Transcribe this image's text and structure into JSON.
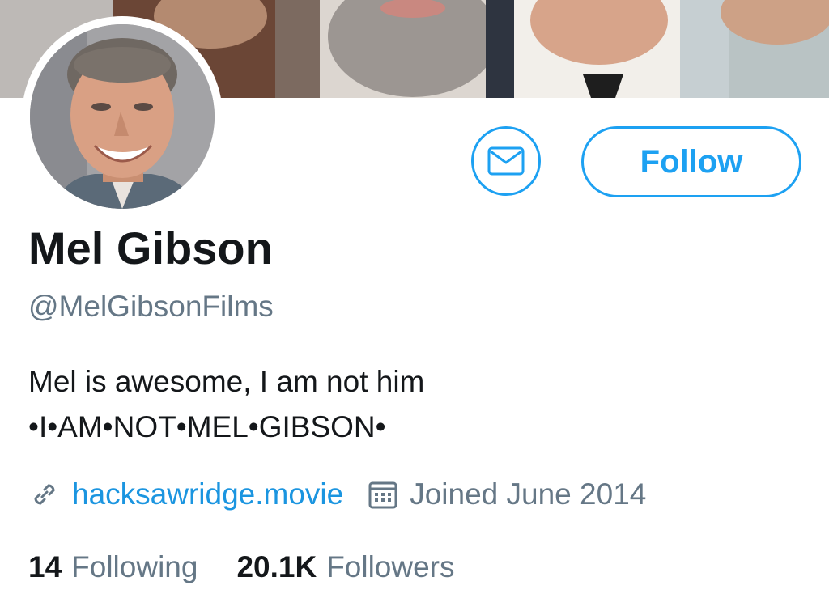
{
  "banner": {
    "colors": [
      "#b9b6b4",
      "#5a3a2c",
      "#a89488",
      "#4a4442",
      "#e8e2dc",
      "#c9b8a8",
      "#9fb0b8"
    ]
  },
  "profile": {
    "name": "Mel Gibson",
    "handle": "@MelGibsonFilms",
    "bio_lines": [
      "Mel is awesome, I am not him",
      "•I•AM•NOT•MEL•GIBSON•"
    ],
    "website": "hacksawridge.movie",
    "joined": "Joined June 2014"
  },
  "actions": {
    "follow_label": "Follow",
    "message_icon": "envelope-icon"
  },
  "stats": {
    "following_count": "14",
    "following_label": "Following",
    "followers_count": "20.1K",
    "followers_label": "Followers"
  },
  "colors": {
    "accent": "#1da1f2",
    "link": "#1b95e0",
    "muted": "#657786",
    "text": "#14171a"
  }
}
